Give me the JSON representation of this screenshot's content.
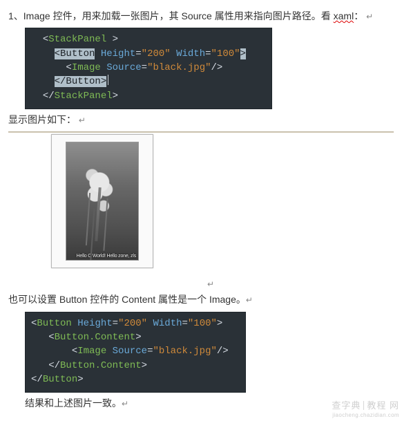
{
  "intro": {
    "number": "1、",
    "text_a": "Image 控件，用来加载一张图片，其 Source 属性用来指向图片路径。看 ",
    "xaml_word": "xaml",
    "colon": "："
  },
  "code1": {
    "l1": {
      "lt": "<",
      "tag": "StackPanel",
      "sp": " ",
      "gt": ">"
    },
    "l2": {
      "lt": "<",
      "tag": "Button",
      "sp1": " ",
      "attr1": "Height",
      "eq1": "=",
      "val1": "\"200\"",
      "sp2": " ",
      "attr2": "Width",
      "eq2": "=",
      "val2": "\"100\"",
      "gt": ">"
    },
    "l3": {
      "lt": "<",
      "tag": "Image",
      "sp": " ",
      "attr": "Source",
      "eq": "=",
      "val": "\"black.jpg\"",
      "sl": "/>"
    },
    "l4": {
      "lt": "</",
      "tag": "Button",
      "gt": ">"
    },
    "l5": {
      "lt": "</",
      "tag": "StackPanel",
      "gt": ">"
    }
  },
  "mid1": "显示图片如下：",
  "photo_caption": "Hello C World!  Hello zone, zls",
  "mid2_a": "也可以设置 Button 控件的 Content 属性是一个 Image。",
  "code2": {
    "l1": {
      "lt": "<",
      "tag": "Button",
      "sp1": " ",
      "attr1": "Height",
      "eq1": "=",
      "val1": "\"200\"",
      "sp2": " ",
      "attr2": "Width",
      "eq2": "=",
      "val2": "\"100\"",
      "gt": ">"
    },
    "l2": {
      "lt": "<",
      "tag": "Button.Content",
      "gt": ">"
    },
    "l3": {
      "lt": "<",
      "tag": "Image",
      "sp": " ",
      "attr": "Source",
      "eq": "=",
      "val": "\"black.jpg\"",
      "sl": "/>"
    },
    "l4": {
      "lt": "</",
      "tag": "Button.Content",
      "gt": ">"
    },
    "l5": {
      "lt": "</",
      "tag": "Button",
      "gt": ">"
    }
  },
  "outro": "结果和上述图片一致。",
  "footer": {
    "brand": "查字典",
    "site": "教程 网"
  }
}
